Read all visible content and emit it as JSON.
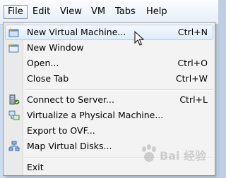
{
  "menubar": {
    "items": [
      {
        "label": "File"
      },
      {
        "label": "Edit"
      },
      {
        "label": "View"
      },
      {
        "label": "VM"
      },
      {
        "label": "Tabs"
      },
      {
        "label": "Help"
      }
    ]
  },
  "file_menu": {
    "items": [
      {
        "label": "New Virtual Machine...",
        "shortcut": "Ctrl+N",
        "icon": "new-vm-icon"
      },
      {
        "label": "New Window",
        "shortcut": "",
        "icon": "new-window-icon"
      },
      {
        "label": "Open...",
        "shortcut": "Ctrl+O",
        "icon": ""
      },
      {
        "label": "Close Tab",
        "shortcut": "Ctrl+W",
        "icon": ""
      },
      {
        "label": "Connect to Server...",
        "shortcut": "Ctrl+L",
        "icon": "connect-server-icon"
      },
      {
        "label": "Virtualize a Physical Machine...",
        "shortcut": "",
        "icon": "virtualize-physical-icon"
      },
      {
        "label": "Export to OVF...",
        "shortcut": "",
        "icon": ""
      },
      {
        "label": "Map Virtual Disks...",
        "shortcut": "",
        "icon": "map-disks-icon"
      },
      {
        "label": "Exit",
        "shortcut": "",
        "icon": ""
      }
    ]
  },
  "watermark": {
    "text": "Bai 经验"
  }
}
